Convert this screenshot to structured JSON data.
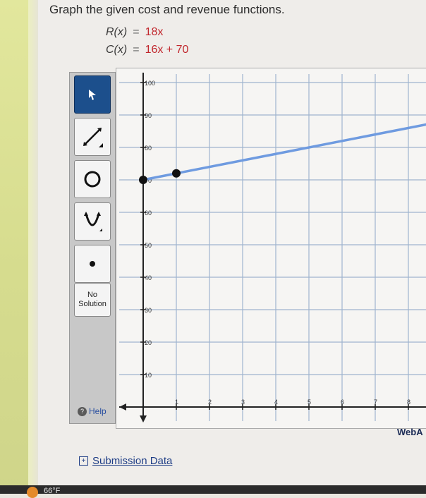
{
  "question": {
    "title": "Graph the given cost and revenue functions.",
    "revenue": {
      "name": "R(x)",
      "eq": "=",
      "expr": "18x"
    },
    "cost": {
      "name": "C(x)",
      "eq": "=",
      "expr": "16x + 70"
    }
  },
  "toolbar": {
    "tools": [
      {
        "name": "pointer-tool",
        "icon": "arrow-cursor-icon",
        "selected": true
      },
      {
        "name": "line-tool",
        "icon": "line-icon"
      },
      {
        "name": "circle-tool",
        "icon": "circle-icon"
      },
      {
        "name": "parabola-tool",
        "icon": "parabola-icon"
      },
      {
        "name": "point-tool",
        "icon": "point-icon"
      }
    ],
    "no_solution_line1": "No",
    "no_solution_line2": "Solution",
    "help_label": "Help"
  },
  "graph": {
    "y_ticks": [
      "100",
      "90",
      "80",
      "70",
      "60",
      "50",
      "40",
      "30",
      "20",
      "10"
    ],
    "x_ticks": [
      "1",
      "2",
      "3",
      "4",
      "5",
      "6",
      "7",
      "8"
    ],
    "line_color": "#6f9be0",
    "point_color": "#111111",
    "plotted_points": [
      {
        "x": 0,
        "y": 70
      },
      {
        "x": 1,
        "y": 72
      }
    ]
  },
  "branding": "WebA",
  "submission_label": "Submission Data",
  "submission_icon": "+",
  "taskbar": {
    "temperature": "66°F"
  }
}
